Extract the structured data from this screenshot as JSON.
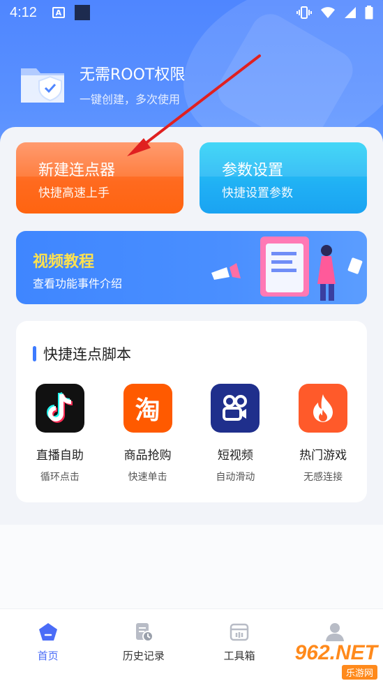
{
  "status_bar": {
    "time": "4:12",
    "a_badge": "A"
  },
  "header": {
    "title": "无需ROOT权限",
    "subtitle": "一键创建，多次使用"
  },
  "cards": {
    "new": {
      "title": "新建连点器",
      "subtitle": "快捷高速上手"
    },
    "param": {
      "title": "参数设置",
      "subtitle": "快捷设置参数"
    }
  },
  "video": {
    "title": "视频教程",
    "subtitle": "查看功能事件介绍"
  },
  "quick": {
    "title": "快捷连点脚本",
    "apps": [
      {
        "name": "直播自助",
        "desc": "循环点击",
        "icon": "tiktok-icon",
        "color": "#111111"
      },
      {
        "name": "商品抢购",
        "desc": "快速单击",
        "icon": "taobao-icon",
        "color": "#ff5a00",
        "glyph": "淘"
      },
      {
        "name": "短视频",
        "desc": "自动滑动",
        "icon": "kuaishou-icon",
        "color": "#1f2f8c"
      },
      {
        "name": "热门游戏",
        "desc": "无感连接",
        "icon": "flame-icon",
        "color": "#ff5a2a"
      }
    ]
  },
  "tabs": [
    {
      "label": "首页",
      "icon": "home-pentagon-icon",
      "active": true
    },
    {
      "label": "历史记录",
      "icon": "history-icon",
      "active": false
    },
    {
      "label": "工具箱",
      "icon": "toolbox-icon",
      "active": false
    },
    {
      "label": "",
      "icon": "profile-icon",
      "active": false
    }
  ],
  "watermark": {
    "brand": "962.NET",
    "sub": "乐游网"
  },
  "colors": {
    "primary": "#4a6cf7",
    "orange": "#ff6a1f",
    "cyan": "#20b0f4",
    "arrow": "#e02020"
  }
}
